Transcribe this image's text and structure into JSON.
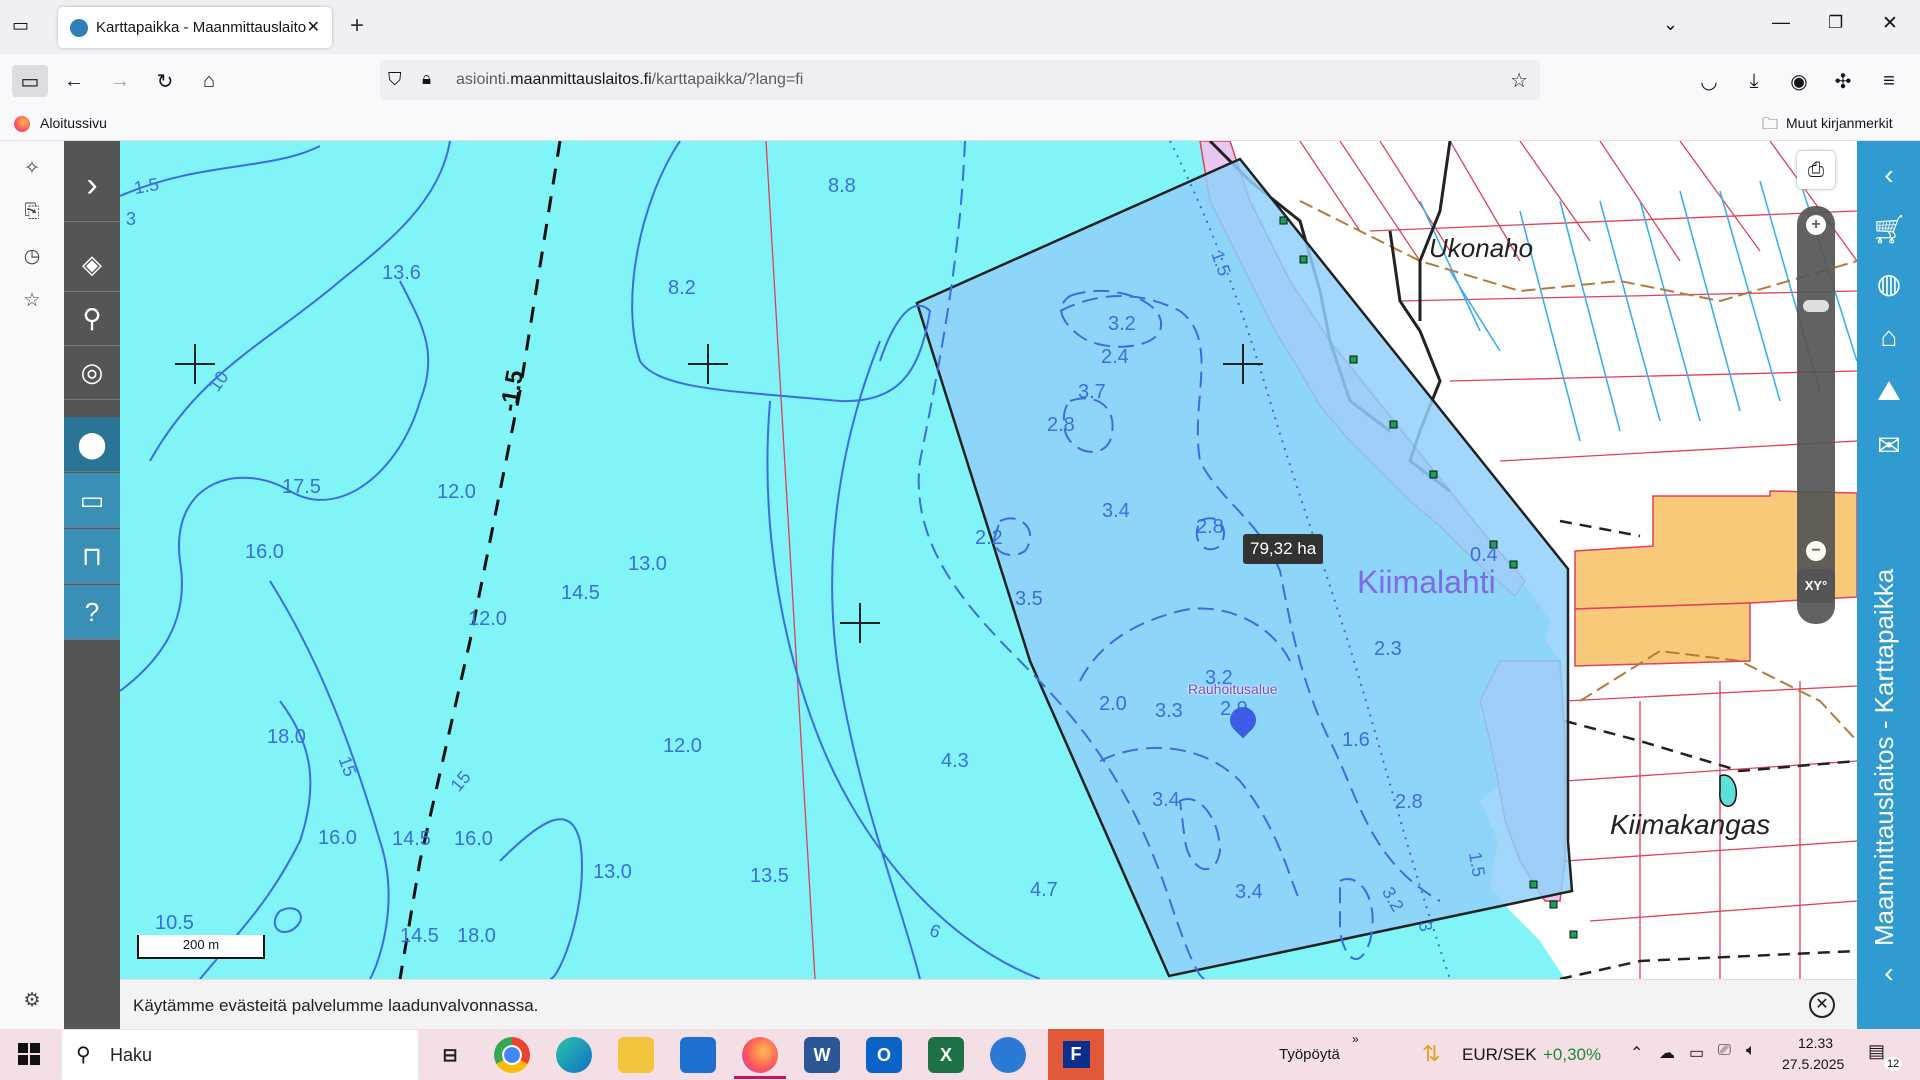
{
  "browser": {
    "tab_title": "Karttapaikka - Maanmittauslaitos",
    "url_prefix": "asiointi.",
    "url_domain": "maanmittauslaitos.fi",
    "url_path": "/karttapaikka/?lang=fi",
    "bookmark_home": "Aloitussivu",
    "bookmark_other": "Muut kirjanmerkit"
  },
  "map": {
    "area_label": "79,32 ha",
    "place_kiimalahti": "Kiimalahti",
    "place_ukonaho": "Ukonaho",
    "place_kiimakangas": "Kiimakangas",
    "marker_label": "Rauhoitusalue",
    "scale_label": "200 m",
    "depths": [
      "8.8",
      "13.6",
      "8.2",
      "17.5",
      "12.0",
      "16.0",
      "13.0",
      "14.5",
      "12.0",
      "18.0",
      "12.0",
      "16.0",
      "14.5",
      "16.0",
      "13.0",
      "13.5",
      "10.5",
      "14.5",
      "18.0",
      "4.3",
      "4.7",
      "3.2",
      "2.4",
      "3.7",
      "2.8",
      "3.4",
      "2.8",
      "2.2",
      "3.5",
      "2.0",
      "3.3",
      "3.2",
      "2.9",
      "3.4",
      "1.6",
      "2.8",
      "3.4",
      "2.3",
      "0.4",
      "3.2"
    ],
    "contours": [
      "1.5",
      "3",
      "10",
      "-1.5",
      "15",
      "15",
      "1.5",
      "1.5",
      "6",
      "3"
    ],
    "xy_button": "XY°"
  },
  "side_panel": {
    "title": "Maanmittauslaitos - Karttapaikka"
  },
  "cookie_notice": "Käytämme evästeitä palvelumme laadunvalvonnassa.",
  "taskbar": {
    "search_placeholder": "Haku",
    "desktop_label": "Työpöytä",
    "currency_pair": "EUR/SEK",
    "currency_change": "+0,30%",
    "time": "12.33",
    "date": "27.5.2025",
    "notifications": "12"
  },
  "colors": {
    "water": "#80f4f6",
    "selection_fill": "#8fd0fa",
    "contour": "#3a6ee0",
    "panel_blue": "#2f9bd0",
    "field_orange": "#f9c97a"
  }
}
